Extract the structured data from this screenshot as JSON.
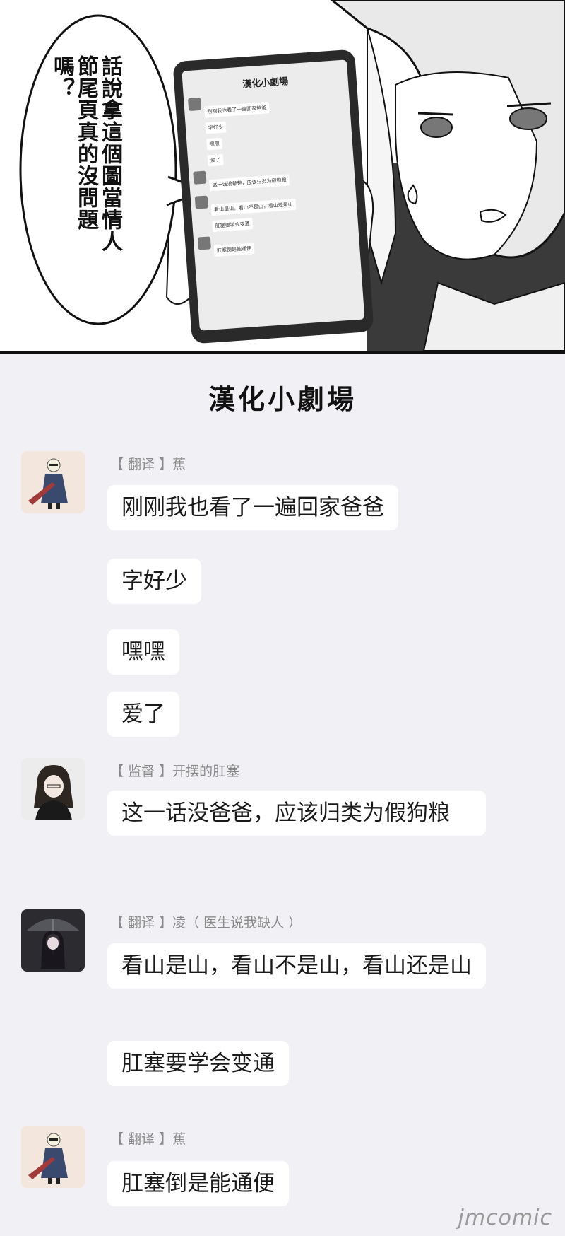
{
  "bubble": {
    "text": "話說拿這個圖當情人節尾頁真的沒問題嗎？"
  },
  "phone_preview": {
    "title": "漢化小劇場",
    "messages": [
      "刚刚我也看了一遍回家爸爸",
      "字好少",
      "嘿嘿",
      "爱了",
      "这一话没爸爸，应该归类为假狗粮",
      "看山是山，看山不是山，看山还是山",
      "肛塞要学会变通",
      "肛塞倒是能通便"
    ]
  },
  "chat": {
    "title": "漢化小劇場",
    "groups": [
      {
        "sender": "【 翻译 】蕉",
        "messages": [
          "刚刚我也看了一遍回家爸爸",
          "字好少",
          "嘿嘿",
          "爱了"
        ]
      },
      {
        "sender": "【 监督 】开摆的肛塞",
        "messages": [
          "这一话没爸爸，应该归类为假狗粮"
        ]
      },
      {
        "sender": "【 翻译 】凌（ 医生说我缺人 ）",
        "messages": [
          "看山是山，看山不是山，看山还是山",
          "肛塞要学会变通"
        ]
      },
      {
        "sender": "【 翻译 】蕉",
        "messages": [
          "肛塞倒是能通便"
        ]
      }
    ]
  },
  "watermark": "jmcomic",
  "colors": {
    "background": "#f1f1f5",
    "bubble": "#ffffff",
    "sender": "#8a8a8a"
  }
}
